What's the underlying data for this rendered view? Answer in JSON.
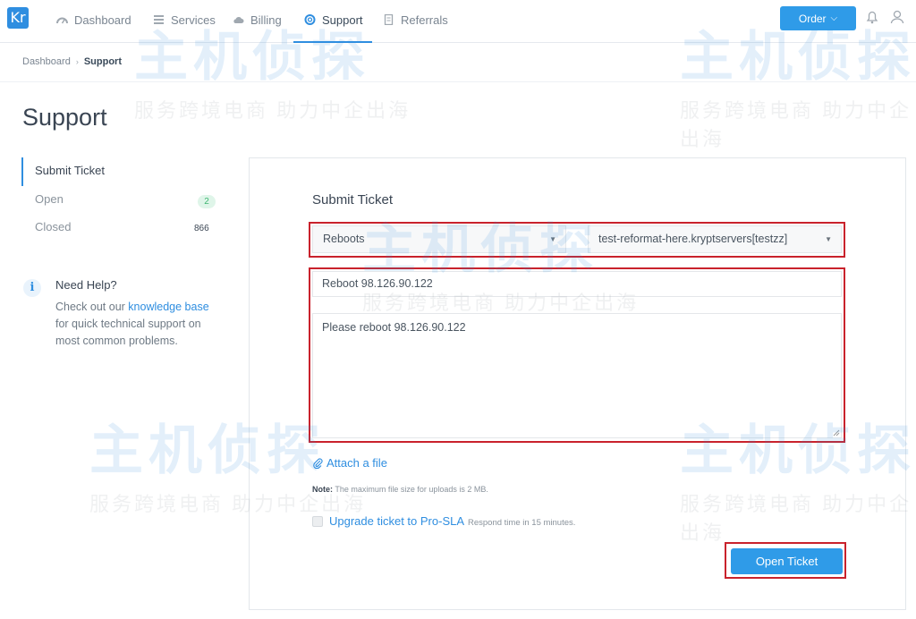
{
  "nav": {
    "logo": "Kr",
    "items": [
      {
        "label": "Dashboard",
        "icon": "speedometer-icon"
      },
      {
        "label": "Services",
        "icon": "list-icon"
      },
      {
        "label": "Billing",
        "icon": "cloud-icon"
      },
      {
        "label": "Support",
        "icon": "lifebuoy-icon"
      },
      {
        "label": "Referrals",
        "icon": "document-icon"
      }
    ],
    "order_label": "Order",
    "accent": "#2f8ee0"
  },
  "breadcrumb": {
    "home": "Dashboard",
    "current": "Support"
  },
  "page_title": "Support",
  "sidebar": {
    "items": [
      {
        "label": "Submit Ticket"
      },
      {
        "label": "Open",
        "count": "2"
      },
      {
        "label": "Closed",
        "count": "866"
      }
    ],
    "help": {
      "title": "Need Help?",
      "text_before": "Check out our ",
      "link": "knowledge base",
      "text_after": " for quick technical support on most common problems."
    }
  },
  "form": {
    "title": "Submit Ticket",
    "department": "Reboots",
    "service": "test-reformat-here.kryptservers[testzz]",
    "subject": "Reboot 98.126.90.122",
    "message": "Please reboot 98.126.90.122",
    "attach": "Attach a file",
    "note_label": "Note:",
    "note_text": " The maximum file size for uploads is 2 MB.",
    "upgrade_label": "Upgrade ticket to Pro-SLA",
    "upgrade_sub": "Respond time in 15 minutes.",
    "submit": "Open Ticket"
  },
  "watermark": {
    "title": "主机侦探",
    "subtitle": "服务跨境电商 助力中企出海"
  }
}
